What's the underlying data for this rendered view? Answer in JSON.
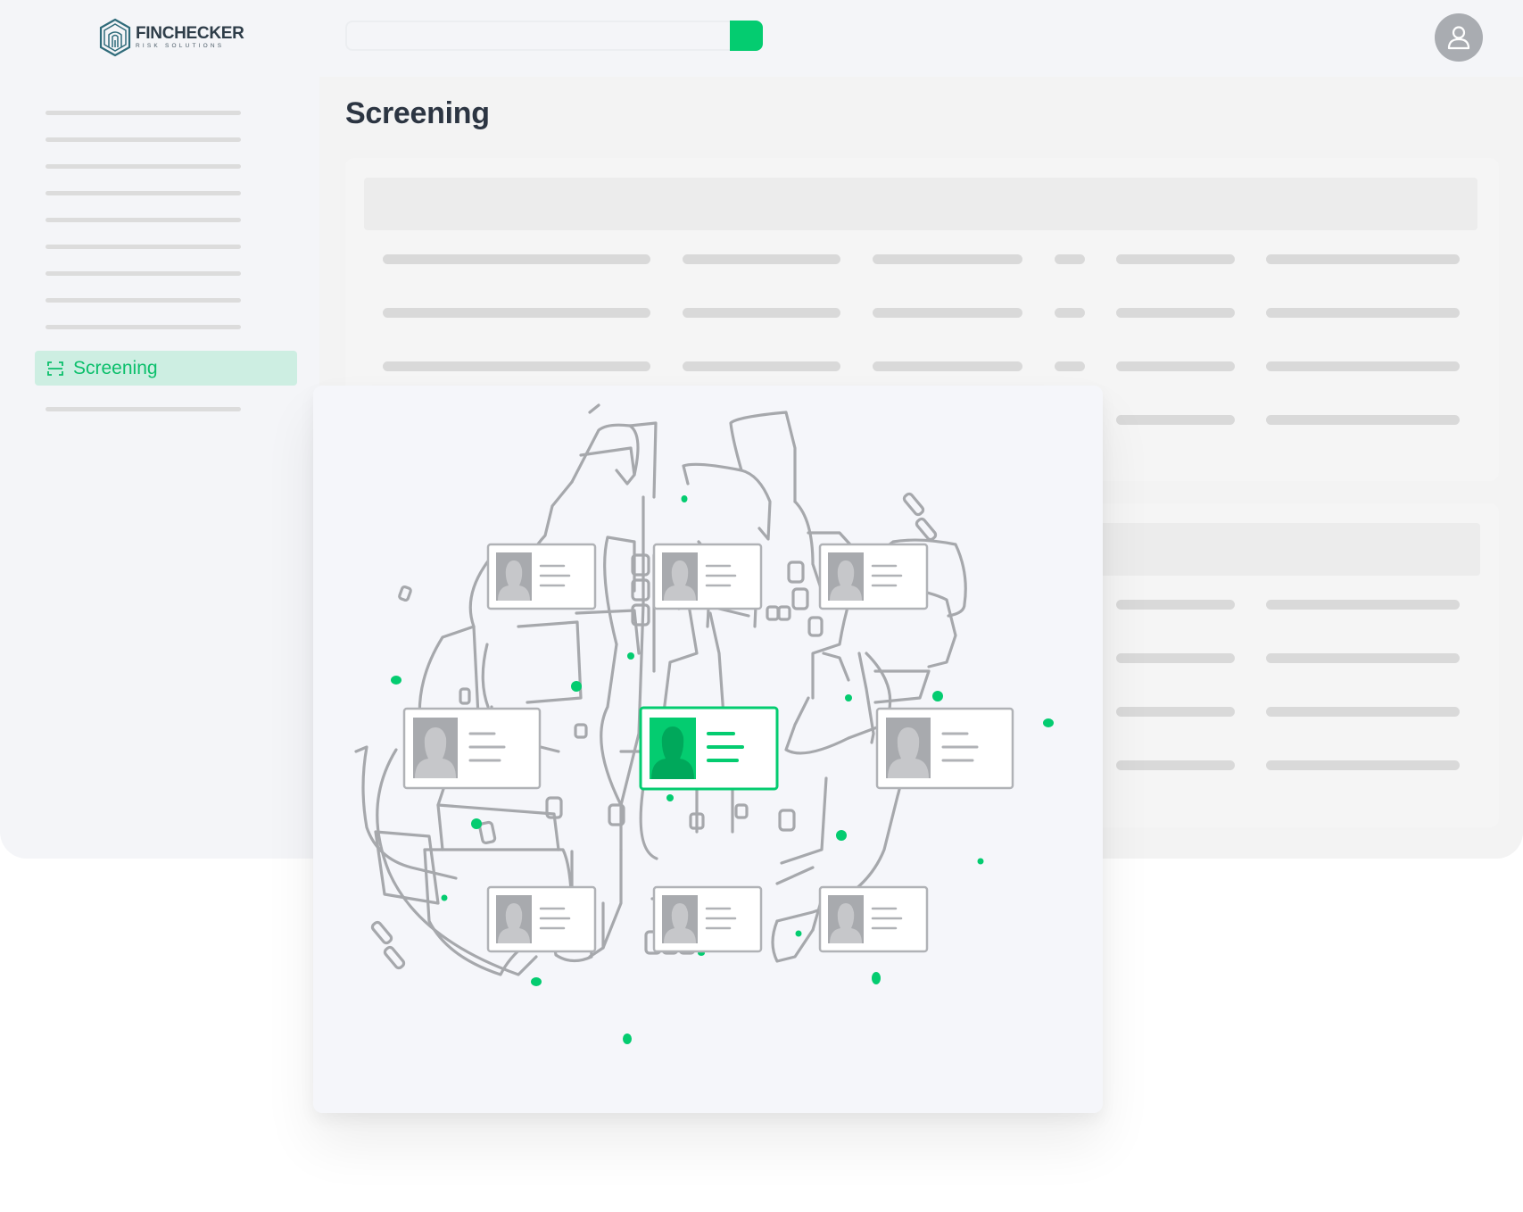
{
  "brand": {
    "name": "FINCHECKER",
    "tagline": "RISK SOLUTIONS",
    "accent_color": "#04cc70",
    "logo_icon": "fingerprint-hexagon-icon"
  },
  "header": {
    "search": {
      "value": "",
      "placeholder": ""
    },
    "search_button_icon": "search-icon",
    "avatar_icon": "user-icon"
  },
  "sidebar": {
    "active_item": {
      "label": "Screening",
      "icon": "scan-frame-icon"
    }
  },
  "page": {
    "title": "Screening"
  },
  "illustration": {
    "subject": "network of identity cards",
    "highlight_color": "#04cc70",
    "line_color": "#a6a8ac"
  }
}
